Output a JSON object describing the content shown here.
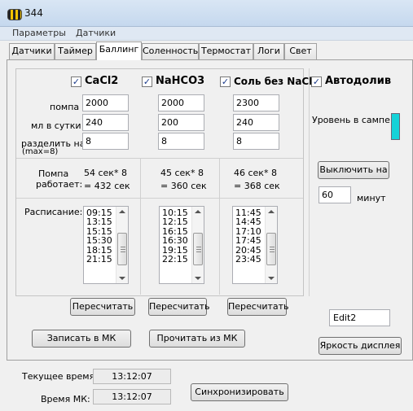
{
  "window": {
    "title": "344"
  },
  "menu": [
    "Параметры",
    "Датчики"
  ],
  "tabs": [
    "Датчики",
    "Таймер",
    "Баллинг",
    "Соленность",
    "Термостат",
    "Логи",
    "Свет"
  ],
  "dosers": [
    {
      "name": "CaCl2",
      "checked": true,
      "pump": "2000",
      "ml_per_day": "240",
      "divide": "8",
      "work_line1": "54 сек* 8",
      "work_line2": "= 432 сек",
      "schedule": [
        "09:15",
        "13:15",
        "15:15",
        "15:30",
        "18:15",
        "21:15"
      ],
      "recalc_label": "Пересчитать"
    },
    {
      "name": "NaHCO3",
      "checked": true,
      "pump": "2000",
      "ml_per_day": "200",
      "divide": "8",
      "work_line1": "45 сек* 8",
      "work_line2": "= 360 сек",
      "schedule": [
        "10:15",
        "12:15",
        "16:15",
        "16:30",
        "19:15",
        "22:15"
      ],
      "recalc_label": "Пересчитать"
    },
    {
      "name": "Соль без NaCl",
      "checked": true,
      "pump": "2300",
      "ml_per_day": "240",
      "divide": "8",
      "work_line1": "46 сек* 8",
      "work_line2": "= 368 сек",
      "schedule": [
        "11:45",
        "14:45",
        "17:10",
        "17:45",
        "20:45",
        "23:45"
      ],
      "recalc_label": "Пересчитать"
    }
  ],
  "labels": {
    "pump": "помпа",
    "ml_per_day": "мл в сутки",
    "divide_line1": "разделить на",
    "divide_line2": "(max=8)",
    "pump_works_line1": "Помпа",
    "pump_works_line2": "работает:",
    "schedule": "Расписание:"
  },
  "autofill": {
    "label": "Автодолив",
    "checked": true,
    "level_label": "Уровень в сампе:",
    "level_color": "#15d2d8",
    "disable_button": "Выключить на",
    "minutes_value": "60",
    "minutes_label": "минут",
    "edit2_value": "Edit2",
    "brightness_button": "Яркость дисплея"
  },
  "actions": {
    "write_mk": "Записать в МК",
    "read_mk": "Прочитать из МК"
  },
  "footer": {
    "current_time_label": "Текущее время:",
    "current_time": "13:12:07",
    "mk_time_label": "Время МК:",
    "mk_time": "13:12:07",
    "sync_button": "Синхронизировать"
  },
  "colors": {
    "check": "#1a3a8a",
    "indicator": "#15d2d8"
  }
}
